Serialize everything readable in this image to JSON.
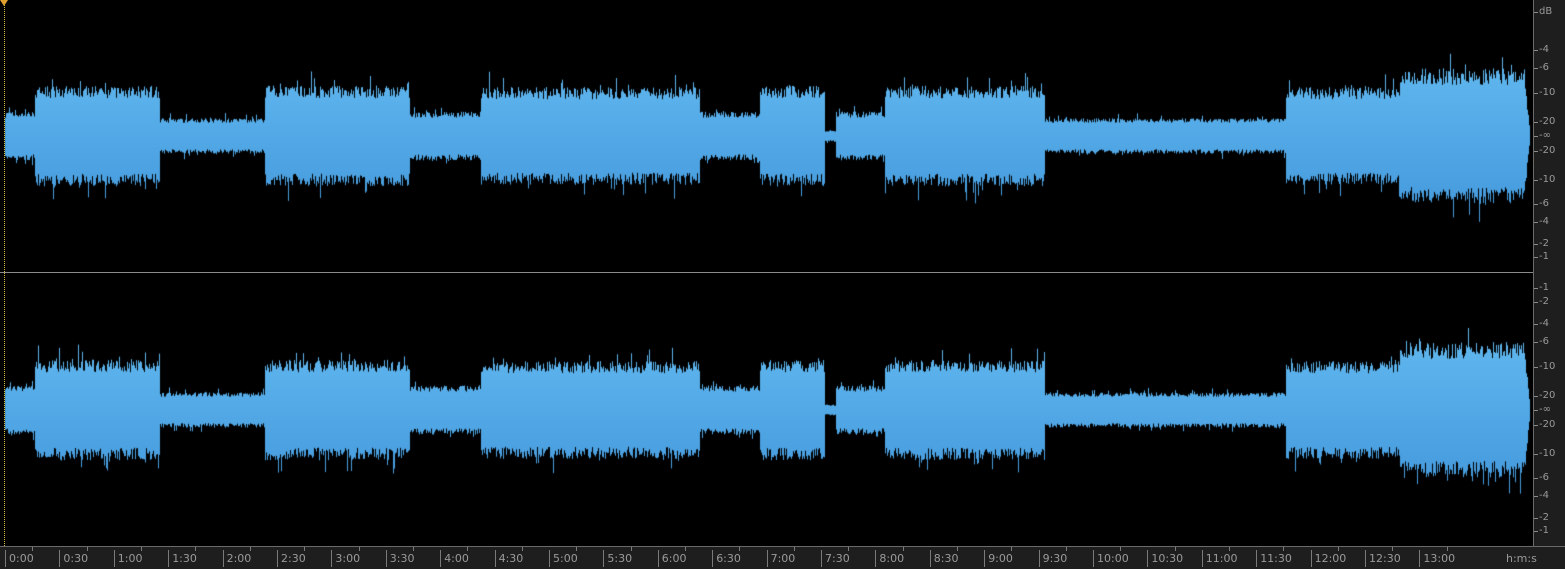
{
  "colors": {
    "wave_top": "#6cc4f6",
    "wave_bottom": "#3a8ed6",
    "background": "#000000"
  },
  "db_scale": {
    "unit": "dB",
    "channel1": [
      "-4",
      "-6",
      "-10",
      "-20",
      "-∞",
      "-20",
      "-10",
      "-6",
      "-4",
      "-2",
      "-1"
    ],
    "channel2": [
      "-1",
      "-2",
      "-4",
      "-6",
      "-10",
      "-20",
      "-∞",
      "-20",
      "-10",
      "-6",
      "-4",
      "-2",
      "-1"
    ]
  },
  "time_ruler": {
    "labels": [
      "0:00",
      "0:30",
      "1:00",
      "1:30",
      "2:00",
      "2:30",
      "3:00",
      "3:30",
      "4:00",
      "4:30",
      "5:00",
      "5:30",
      "6:00",
      "6:30",
      "7:00",
      "7:30",
      "8:00",
      "8:30",
      "9:00",
      "9:30",
      "10:00",
      "10:30",
      "11:00",
      "11:30",
      "12:00",
      "12:30",
      "13:00"
    ],
    "format": "h:m:s"
  },
  "waveform_envelope_seconds": [
    [
      0,
      16.5,
      0.18
    ],
    [
      16.5,
      85,
      0.37
    ],
    [
      85,
      143,
      0.13
    ],
    [
      143,
      223,
      0.37
    ],
    [
      223,
      262,
      0.18
    ],
    [
      262,
      383,
      0.36
    ],
    [
      383,
      416,
      0.18
    ],
    [
      416,
      452,
      0.37
    ],
    [
      452,
      458,
      0.04
    ],
    [
      458,
      485,
      0.18
    ],
    [
      485,
      573,
      0.37
    ],
    [
      573,
      706,
      0.13
    ],
    [
      706,
      769,
      0.36
    ],
    [
      769,
      841,
      0.5
    ]
  ]
}
